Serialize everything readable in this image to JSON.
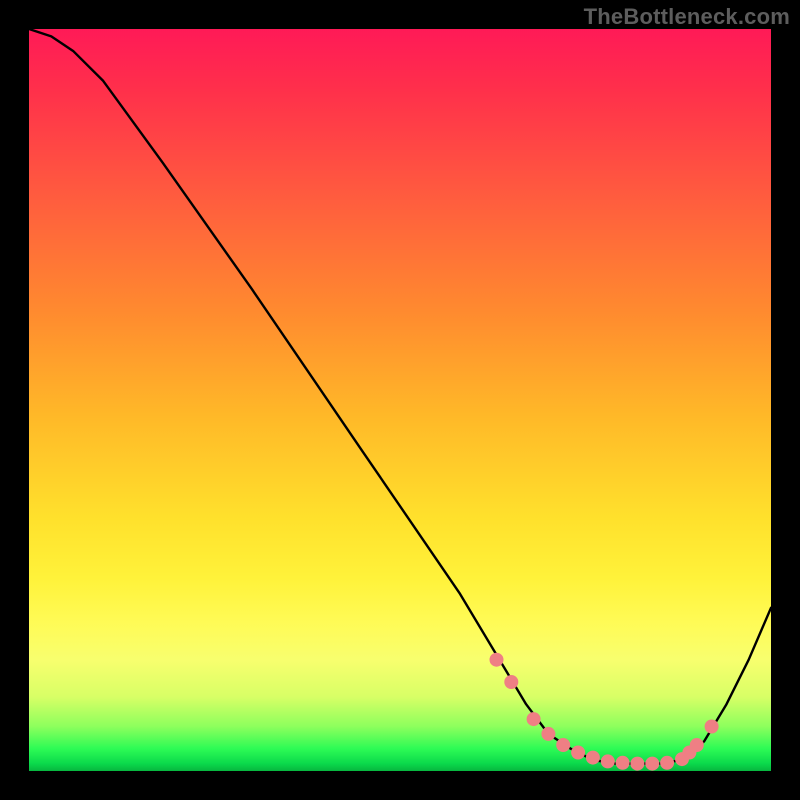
{
  "watermark": "TheBottleneck.com",
  "chart_data": {
    "type": "line",
    "title": "",
    "xlabel": "",
    "ylabel": "",
    "xlim": [
      0,
      100
    ],
    "ylim": [
      0,
      100
    ],
    "series": [
      {
        "name": "curve",
        "x": [
          0,
          3,
          6,
          10,
          18,
          30,
          45,
          58,
          64,
          67,
          70,
          73,
          76,
          79,
          82,
          85,
          88,
          91,
          94,
          97,
          100
        ],
        "y": [
          100,
          99,
          97,
          93,
          82,
          65,
          43,
          24,
          14,
          9,
          5,
          3,
          1.5,
          1.0,
          1.0,
          1.0,
          1.5,
          4,
          9,
          15,
          22
        ]
      }
    ],
    "markers": {
      "name": "highlighted-points",
      "x": [
        63,
        65,
        68,
        70,
        72,
        74,
        76,
        78,
        80,
        82,
        84,
        86,
        88,
        89,
        90,
        92
      ],
      "y": [
        15,
        12,
        7,
        5,
        3.5,
        2.5,
        1.8,
        1.3,
        1.1,
        1.0,
        1.0,
        1.1,
        1.6,
        2.5,
        3.5,
        6
      ]
    },
    "gradient_stops": [
      {
        "pos": 0,
        "color": "#ff1a57"
      },
      {
        "pos": 22,
        "color": "#ff5a3f"
      },
      {
        "pos": 52,
        "color": "#ffb828"
      },
      {
        "pos": 80,
        "color": "#fffb56"
      },
      {
        "pos": 94,
        "color": "#8dff5d"
      },
      {
        "pos": 100,
        "color": "#07b73f"
      }
    ]
  }
}
